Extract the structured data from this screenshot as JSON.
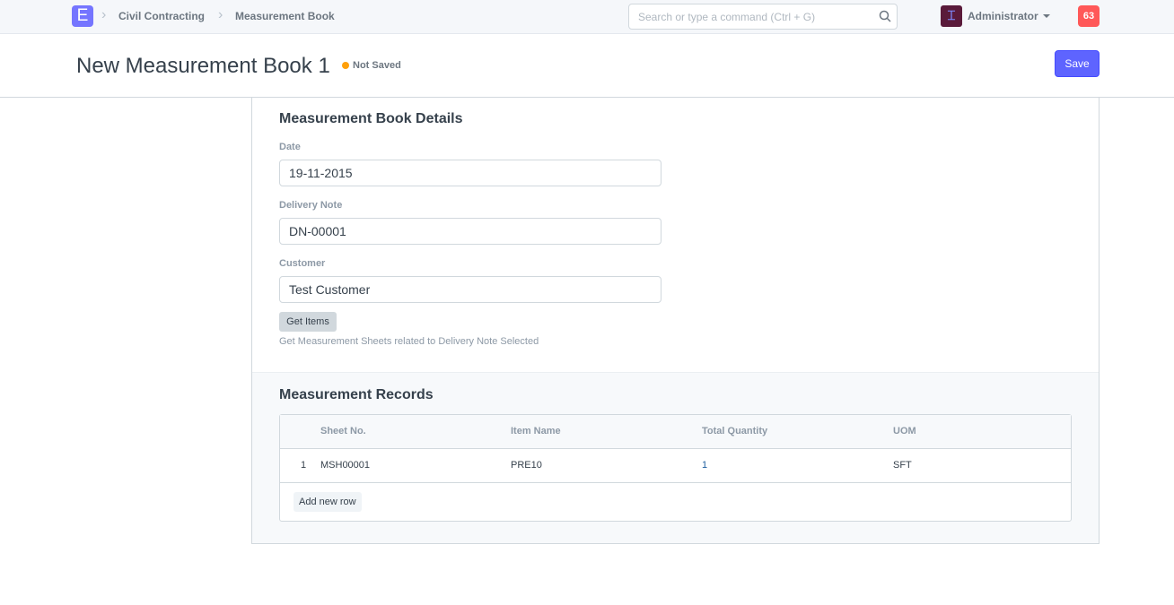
{
  "navbar": {
    "logo": "E",
    "breadcrumbs": [
      "Civil Contracting",
      "Measurement Book"
    ],
    "search_placeholder": "Search or type a command (Ctrl + G)",
    "user": "Administrator",
    "notifications": "63"
  },
  "page": {
    "title": "New Measurement Book 1",
    "status": "Not Saved",
    "save_label": "Save"
  },
  "details": {
    "heading": "Measurement Book Details",
    "date_label": "Date",
    "date": "19-11-2015",
    "delivery_label": "Delivery Note",
    "delivery": "DN-00001",
    "customer_label": "Customer",
    "customer": "Test Customer",
    "get_items": "Get Items",
    "help": "Get Measurement Sheets related to Delivery Note Selected"
  },
  "records": {
    "heading": "Measurement Records",
    "columns": [
      "Sheet No.",
      "Item Name",
      "Total Quantity",
      "UOM"
    ],
    "rows": [
      {
        "idx": "1",
        "sheet": "MSH00001",
        "item": "PRE10",
        "qty": "1",
        "uom": "SFT"
      }
    ],
    "add_row": "Add new row"
  }
}
